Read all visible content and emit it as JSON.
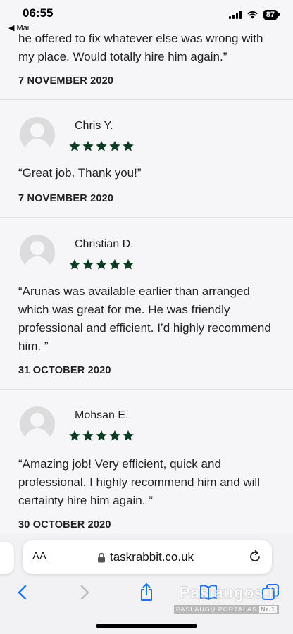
{
  "status_bar": {
    "time": "06:55",
    "back_app": "◀ Mail",
    "battery": "87"
  },
  "partial_review": {
    "text": "he offered to fix whatever else was wrong with my place. Would totally hire him again.”",
    "date": "7 NOVEMBER 2020"
  },
  "reviews": [
    {
      "name": "Chris Y.",
      "rating": 5,
      "text": "“Great job. Thank you!”",
      "date": "7 NOVEMBER 2020"
    },
    {
      "name": "Christian D.",
      "rating": 5,
      "text": "“Arunas was available earlier than arranged which was great for me. He was friendly professional and efficient. I’d highly recommend him. ”",
      "date": "31 OCTOBER 2020"
    },
    {
      "name": "Mohsan E.",
      "rating": 5,
      "text": "“Amazing job! Very efficient, quick and professional. I highly recommend him and will certainty hire him again. ”",
      "date": "30 OCTOBER 2020"
    }
  ],
  "browser": {
    "text_size_label": "AA",
    "url": "taskrabbit.co.uk",
    "icons": {
      "lock": "lock-icon",
      "reload": "reload-icon",
      "back": "chevron-left-icon",
      "forward": "chevron-right-icon",
      "share": "share-icon",
      "bookmarks": "book-icon",
      "tabs": "tabs-icon"
    }
  },
  "watermark": {
    "logo": "Paslaugos.lt",
    "tagline": "PASLAUGŲ PORTALAS",
    "badge": "Nr.1"
  },
  "colors": {
    "star": "#0f3d24",
    "accent": "#1a73e8",
    "background": "#f6f6f8"
  }
}
